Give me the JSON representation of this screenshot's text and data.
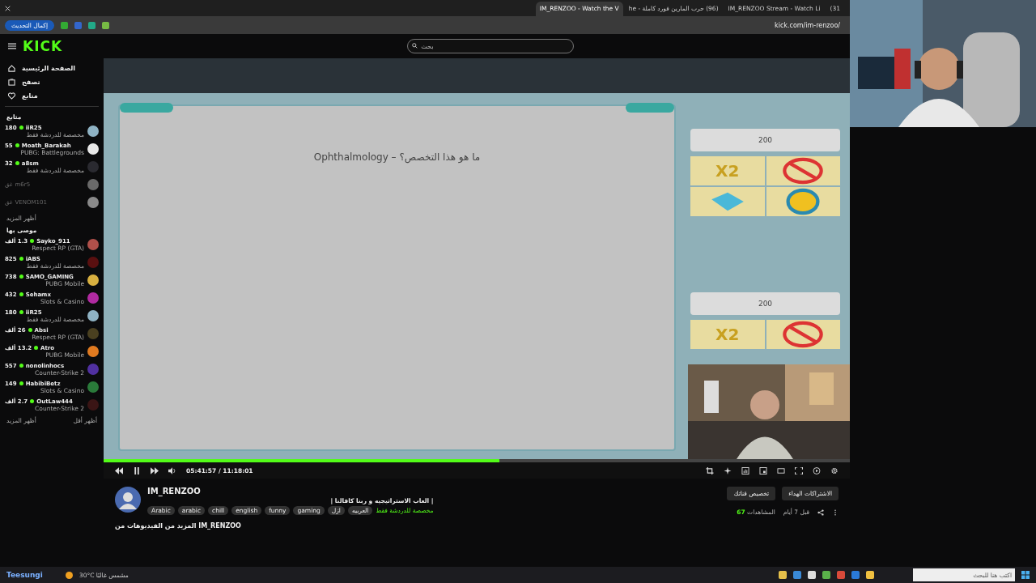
{
  "browser": {
    "tabs": [
      {
        "title": "(31",
        "selected": false
      },
      {
        "title": "IM_RENZOO Stream - Watch Li",
        "selected": false
      },
      {
        "title": "(96) حرب المارين فورد كاملة - he",
        "selected": false
      },
      {
        "title": "IM_RENZOO - Watch the V",
        "selected": true
      }
    ],
    "update_button": "إكمال التحديث",
    "address": "kick.com/im-renzoo/"
  },
  "header": {
    "logo": "KICK",
    "search": {
      "placeholder": "بحث"
    }
  },
  "sidebar": {
    "nav": [
      {
        "label": "الصفحة الرئيسية",
        "kind": "home"
      },
      {
        "label": "تصفح",
        "kind": "browse"
      },
      {
        "label": "متابع",
        "kind": "heart"
      }
    ],
    "followed": {
      "title": "متابع",
      "channels": [
        {
          "name": "iiR25",
          "viewers": "180",
          "category": "مخصصة للدردشة فقط",
          "live": true,
          "color": "#8fb3c4"
        },
        {
          "name": "Moath_Barakah",
          "viewers": "55",
          "category": "PUBG: Battlegrounds",
          "live": true,
          "color": "#e8e8e8"
        },
        {
          "name": "a8sm",
          "viewers": "32",
          "category": "مخصصة للدردشة فقط",
          "live": true,
          "color": "#2a2a30"
        },
        {
          "name": "m6r5",
          "status": "غق",
          "live": false,
          "color": "#6a6a6a"
        },
        {
          "name": "VENOM101",
          "status": "غق",
          "live": false,
          "color": "#8a8a8a"
        }
      ],
      "show_more": "أظهر المزيد"
    },
    "recommended": {
      "title": "موصى بها",
      "channels": [
        {
          "name": "Sayko_911",
          "viewers": "1.3 ألف",
          "category": "Respect RP (GTA)",
          "live": true,
          "color": "#b0504a"
        },
        {
          "name": "iABS",
          "viewers": "825",
          "category": "مخصصة للدردشة فقط",
          "live": true,
          "color": "#5a1010"
        },
        {
          "name": "SAMO_GAMING",
          "viewers": "738",
          "category": "PUBG Mobile",
          "live": true,
          "color": "#d8b040"
        },
        {
          "name": "Sehamx",
          "viewers": "432",
          "category": "Slots & Casino",
          "live": true,
          "color": "#b02aa0"
        },
        {
          "name": "iiR25",
          "viewers": "180",
          "category": "مخصصة للدردشة فقط",
          "live": true,
          "color": "#8fb3c4"
        },
        {
          "name": "Absi",
          "viewers": "26 ألف",
          "category": "Respect RP (GTA)",
          "live": true,
          "color": "#4a4020"
        },
        {
          "name": "Atro",
          "viewers": "13.2 ألف",
          "category": "PUBG Mobile",
          "live": true,
          "color": "#e07a20"
        },
        {
          "name": "nonolinhocs",
          "viewers": "557",
          "category": "Counter-Strike 2",
          "live": true,
          "color": "#5030a0"
        },
        {
          "name": "HabibiBetz",
          "viewers": "149",
          "category": "Slots & Casino",
          "live": true,
          "color": "#2a7a3a"
        },
        {
          "name": "OutLaw444",
          "viewers": "2.7 ألف",
          "category": "Counter-Strike 2",
          "live": true,
          "color": "#3a1515"
        }
      ],
      "show_less": "أظهر أقل",
      "show_more": "أظهر المزيد"
    }
  },
  "video": {
    "question": "Ophthalmology – ما هو هذا التخصص؟",
    "cards": [
      {
        "value": "200",
        "tiles": [
          {
            "kind": "x2",
            "label": "X2"
          },
          {
            "kind": "no-entry"
          },
          {
            "kind": "cards"
          },
          {
            "kind": "wheel"
          }
        ]
      },
      {
        "value": "200",
        "tiles": [
          {
            "kind": "x2",
            "label": "X2"
          },
          {
            "kind": "no-entry"
          }
        ]
      }
    ]
  },
  "player": {
    "playing": true,
    "time": "05:41:57 / 11:18:01",
    "progress": {
      "level": 0.53
    }
  },
  "channel": {
    "name": "IM_RENZOO",
    "description": "| العاب الاستراتيجيه و ربنا كافالنا |",
    "category": "مخصصة للدردشة فقط",
    "tags": [
      "العربيه",
      "ازل",
      "gaming",
      "funny",
      "english",
      "chill",
      "arabic",
      "Arabic"
    ],
    "buttons": [
      "الاشتراكات الهداء",
      "تخصيص قناتك"
    ],
    "views": "67",
    "views_label": "المشاهدات",
    "age": "قبل 7 أيام",
    "more_videos": "المزيد من الفيديوهات من IM_RENZOO"
  },
  "taskbar": {
    "overlay_text": "Teesungi",
    "temperature": "30°C",
    "weather": "مشمس غالبًا",
    "search": {
      "placeholder": "اكتب هنا للبحث"
    }
  }
}
